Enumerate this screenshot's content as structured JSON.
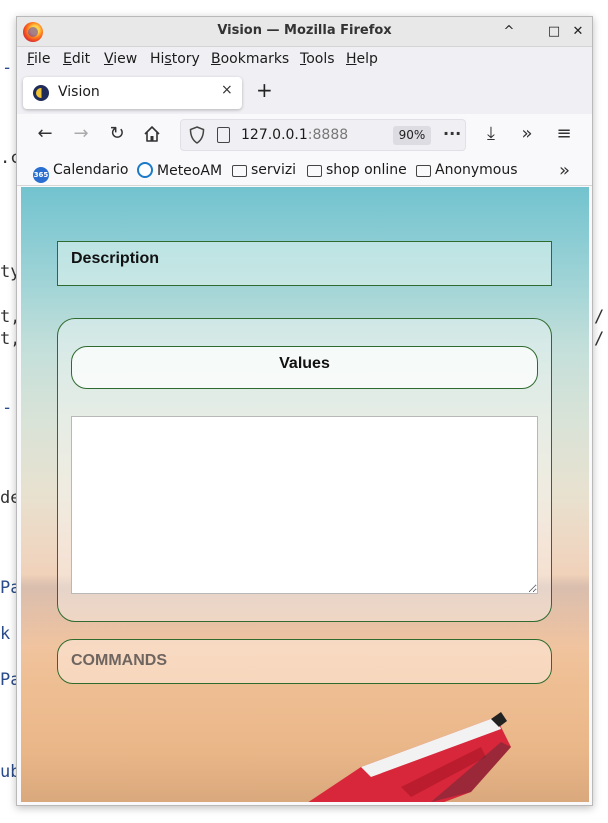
{
  "background_text": {
    "fragments": [
      "-",
      ".c",
      "ty",
      "t,",
      "t,",
      "-",
      "de",
      "Pa",
      "k",
      "Pa",
      "ub",
      "/",
      "/"
    ]
  },
  "window": {
    "title": "Vision — Mozilla Firefox",
    "controls": {
      "minimize": "^",
      "maximize": "□",
      "close": "✕"
    }
  },
  "menubar": {
    "items": [
      {
        "label": "File",
        "accel": "F",
        "rest": "ile"
      },
      {
        "label": "Edit",
        "accel": "E",
        "rest": "dit"
      },
      {
        "label": "View",
        "accel": "V",
        "rest": "iew"
      },
      {
        "label": "History",
        "pre": "Hi",
        "accel": "s",
        "rest": "tory"
      },
      {
        "label": "Bookmarks",
        "accel": "B",
        "rest": "ookmarks"
      },
      {
        "label": "Tools",
        "accel": "T",
        "rest": "ools"
      },
      {
        "label": "Help",
        "accel": "H",
        "rest": "elp"
      }
    ]
  },
  "tabs": [
    {
      "title": "Vision",
      "close": "×"
    }
  ],
  "new_tab": "+",
  "navbar": {
    "back": "←",
    "forward": "→",
    "reload": "↻",
    "url_host": "127.0.0.1",
    "url_port": ":8888",
    "zoom": "90%",
    "page_actions": "···",
    "download": "⤓",
    "overflow": "»",
    "menu": "≡"
  },
  "bookmarks": {
    "items": [
      {
        "label": "Calendario",
        "icon": "calendar-365-icon",
        "badge": "365"
      },
      {
        "label": "MeteoAM",
        "icon": "meteo-icon"
      },
      {
        "label": "servizi",
        "icon": "folder-icon"
      },
      {
        "label": "shop online",
        "icon": "folder-icon"
      },
      {
        "label": "Anonymous",
        "icon": "folder-icon"
      }
    ],
    "overflow": "»"
  },
  "page": {
    "description": {
      "title": "Description"
    },
    "values": {
      "title": "Values",
      "textarea_value": ""
    },
    "commands": {
      "title": "COMMANDS"
    }
  },
  "colors": {
    "panel_border": "#2f6b2f",
    "sky_top": "#72c3cf",
    "sand_bottom": "#d9a87c",
    "boat_red": "#d8273a"
  }
}
